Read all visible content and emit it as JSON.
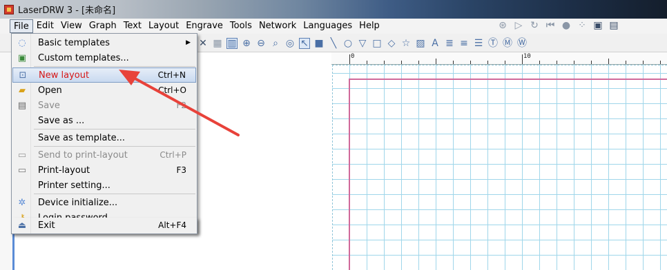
{
  "window": {
    "title": "LaserDRW 3 - [未命名]",
    "app_icon": "laserdrw-icon"
  },
  "menubar": {
    "items": [
      {
        "label": "File",
        "active": true
      },
      {
        "label": "Edit"
      },
      {
        "label": "View"
      },
      {
        "label": "Graph"
      },
      {
        "label": "Text"
      },
      {
        "label": "Layout"
      },
      {
        "label": "Engrave"
      },
      {
        "label": "Tools"
      },
      {
        "label": "Network"
      },
      {
        "label": "Languages"
      },
      {
        "label": "Help"
      }
    ]
  },
  "file_menu": {
    "items": [
      {
        "label": "Basic templates",
        "shortcut": "",
        "icon": "template-icon",
        "submenu": true,
        "disabled": false
      },
      {
        "label": "Custom templates...",
        "shortcut": "",
        "icon": "custom-template-icon",
        "disabled": false
      },
      {
        "label": "New layout",
        "shortcut": "Ctrl+N",
        "icon": "new-layout-icon",
        "highlighted": true,
        "disabled": false
      },
      {
        "label": "Open",
        "shortcut": "Ctrl+O",
        "icon": "open-folder-icon",
        "disabled": false
      },
      {
        "label": "Save",
        "shortcut": "F2",
        "icon": "save-icon",
        "disabled": true
      },
      {
        "label": "Save as ...",
        "shortcut": "",
        "icon": "",
        "disabled": false
      },
      {
        "label": "Save as template...",
        "shortcut": "",
        "icon": "",
        "disabled": false
      },
      {
        "label": "Send to print-layout",
        "shortcut": "Ctrl+P",
        "icon": "print-layout-icon",
        "disabled": true
      },
      {
        "label": "Print-layout",
        "shortcut": "F3",
        "icon": "printer-icon",
        "disabled": false
      },
      {
        "label": "Printer setting...",
        "shortcut": "",
        "icon": "",
        "disabled": false
      },
      {
        "label": "Device initialize...",
        "shortcut": "",
        "icon": "gear-icon",
        "disabled": false
      },
      {
        "label": "Login password...",
        "shortcut": "",
        "icon": "key-icon",
        "disabled": false
      },
      {
        "label": "Exit",
        "shortcut": "Alt+F4",
        "icon": "exit-icon",
        "disabled": false
      }
    ]
  },
  "ruler": {
    "labels": [
      "0",
      "10"
    ]
  },
  "colors": {
    "highlight_text": "#d61616",
    "annotation_arrow": "#e8423a",
    "grid": "#9fd6ea",
    "margin": "#d0699a"
  }
}
